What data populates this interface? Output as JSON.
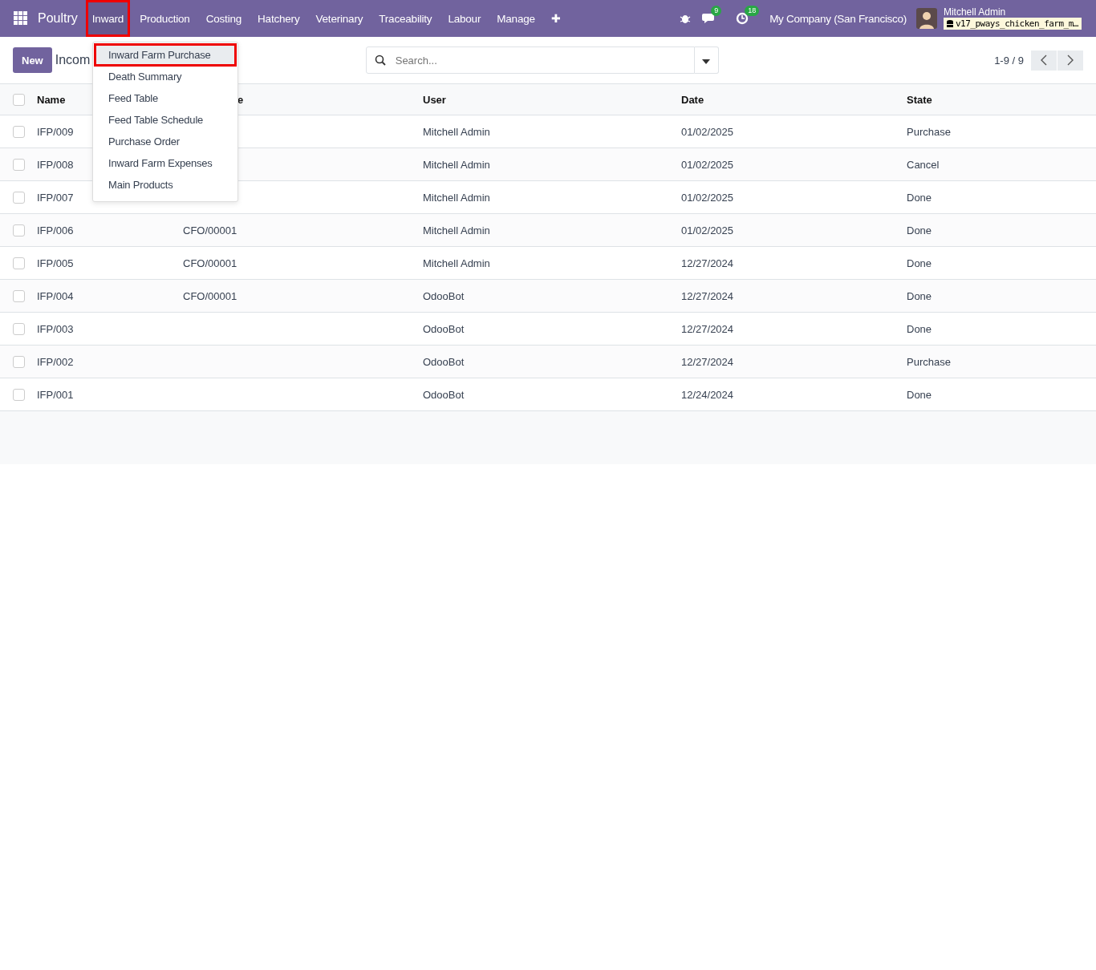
{
  "navbar": {
    "app_name": "Poultry",
    "menu": [
      {
        "label": "Inward",
        "selected": true,
        "highlighted": true
      },
      {
        "label": "Production",
        "selected": false,
        "highlighted": false
      },
      {
        "label": "Costing",
        "selected": false,
        "highlighted": false
      },
      {
        "label": "Hatchery",
        "selected": false,
        "highlighted": false
      },
      {
        "label": "Veterinary",
        "selected": false,
        "highlighted": false
      },
      {
        "label": "Traceability",
        "selected": false,
        "highlighted": false
      },
      {
        "label": "Labour",
        "selected": false,
        "highlighted": false
      },
      {
        "label": "Manage",
        "selected": false,
        "highlighted": false
      }
    ],
    "add_symbol": "✚",
    "messages_badge": "9",
    "activities_badge": "18",
    "company": "My Company (San Francisco)",
    "user_name": "Mitchell Admin",
    "database": "v17_pways_chicken_farm_m…"
  },
  "dropdown": [
    {
      "label": "Inward Farm Purchase",
      "selected": true,
      "highlighted": true
    },
    {
      "label": "Death Summary",
      "selected": false,
      "highlighted": false
    },
    {
      "label": "Feed Table",
      "selected": false,
      "highlighted": false
    },
    {
      "label": "Feed Table Schedule",
      "selected": false,
      "highlighted": false
    },
    {
      "label": "Purchase Order",
      "selected": false,
      "highlighted": false
    },
    {
      "label": "Inward Farm Expenses",
      "selected": false,
      "highlighted": false
    },
    {
      "label": "Main Products",
      "selected": false,
      "highlighted": false
    }
  ],
  "control_panel": {
    "new_button": "New",
    "breadcrumb": "Incom",
    "search_placeholder": "Search...",
    "pager": "1-9 / 9"
  },
  "table": {
    "select_all_checked": false,
    "columns": [
      "Name",
      "e",
      "User",
      "Date",
      "State"
    ],
    "rows": [
      {
        "checked": false,
        "cells": [
          "IFP/009",
          "",
          "Mitchell Admin",
          "01/02/2025",
          "Purchase"
        ]
      },
      {
        "checked": false,
        "cells": [
          "IFP/008",
          "",
          "Mitchell Admin",
          "01/02/2025",
          "Cancel"
        ]
      },
      {
        "checked": false,
        "cells": [
          "IFP/007",
          "",
          "Mitchell Admin",
          "01/02/2025",
          "Done"
        ]
      },
      {
        "checked": false,
        "cells": [
          "IFP/006",
          "CFO/00001",
          "Mitchell Admin",
          "01/02/2025",
          "Done"
        ]
      },
      {
        "checked": false,
        "cells": [
          "IFP/005",
          "CFO/00001",
          "Mitchell Admin",
          "12/27/2024",
          "Done"
        ]
      },
      {
        "checked": false,
        "cells": [
          "IFP/004",
          "CFO/00001",
          "OdooBot",
          "12/27/2024",
          "Done"
        ]
      },
      {
        "checked": false,
        "cells": [
          "IFP/003",
          "",
          "OdooBot",
          "12/27/2024",
          "Done"
        ]
      },
      {
        "checked": false,
        "cells": [
          "IFP/002",
          "",
          "OdooBot",
          "12/27/2024",
          "Purchase"
        ]
      },
      {
        "checked": false,
        "cells": [
          "IFP/001",
          "",
          "OdooBot",
          "12/24/2024",
          "Done"
        ]
      }
    ]
  }
}
